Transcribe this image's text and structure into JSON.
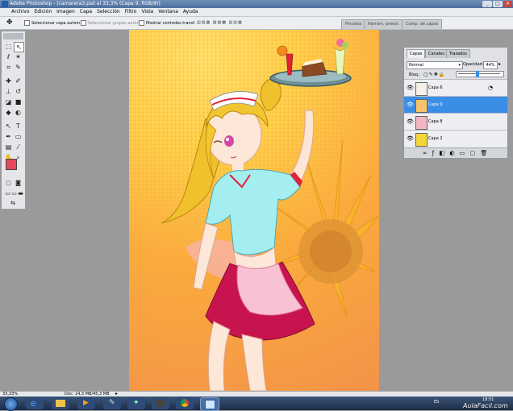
{
  "window": {
    "app_title": "Adobe Photoshop - [camarera3.psd al 33,3% (Capa 9, RGB/8)]",
    "controls": [
      "_",
      "□",
      "×"
    ]
  },
  "menu": [
    "Archivo",
    "Edición",
    "Imagen",
    "Capa",
    "Selección",
    "Filtro",
    "Vista",
    "Ventana",
    "Ayuda"
  ],
  "options": {
    "auto_select_layer": "Seleccionar capa autom.",
    "auto_select_groups": "Seleccionar grupos autom.",
    "show_transform": "Mostrar controles transf.",
    "panel_tabs": [
      "Pinceles",
      "Herram. preest.",
      "Comp. de capas"
    ]
  },
  "layers_panel": {
    "tabs": [
      "Capas",
      "Canales",
      "Trazados"
    ],
    "blend_mode": "Normal",
    "opacity_label": "Opacidad:",
    "opacity_value": "44%",
    "lock_label": "Bloq.:",
    "layers": [
      {
        "name": "Capa 6",
        "selected": false,
        "thumb": "#f6f1e8"
      },
      {
        "name": "Capa 9",
        "selected": true,
        "thumb": "#f6c36a"
      },
      {
        "name": "Capa 8",
        "selected": false,
        "thumb": "#f2b6c3"
      },
      {
        "name": "Capa 2",
        "selected": false,
        "thumb": "#f5d73c"
      }
    ]
  },
  "status": {
    "zoom": "33,33%",
    "doc": "Doc: 14,3 MB/45,3 MB"
  },
  "taskbar": {
    "lang": "ES",
    "time": "18:51",
    "watermark": "AulaFacil.com"
  },
  "colors": {
    "foreground": "#e8475b",
    "background": "#000000",
    "selection": "#3a8ee6"
  }
}
